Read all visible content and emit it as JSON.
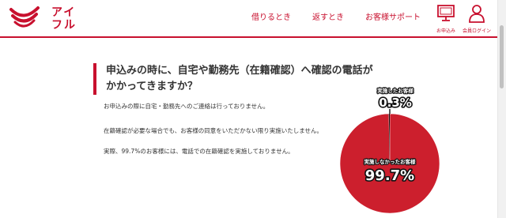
{
  "header": {
    "logo_text_line1": "アイ",
    "logo_text_line2": "フル",
    "nav": [
      "借りるとき",
      "返すとき",
      "お客様サポート"
    ],
    "apply_label": "お申込み",
    "login_label": "会員ログイン"
  },
  "main": {
    "heading": "申込みの時に、自宅や勤務先（在籍確認）へ確認の電話がかかってきますか？",
    "paragraphs": [
      "お申込みの際に自宅・勤務先へのご連絡は行っておりません。",
      "在籍確認が必要な場合でも、お客様の同意をいただかない限り実施いたしません。",
      "実際、99.7%のお客様には、電話での在籍確認を実施しておりません。"
    ]
  },
  "chart_data": {
    "type": "pie",
    "categories": [
      "実施しなかったお客様",
      "実施したお客様"
    ],
    "values": [
      99.7,
      0.3
    ],
    "value_labels": [
      "99.7%",
      "0.3%"
    ],
    "colors": [
      "#cc1f2d",
      "#111111"
    ]
  },
  "colors": {
    "accent": "#c8102e"
  }
}
